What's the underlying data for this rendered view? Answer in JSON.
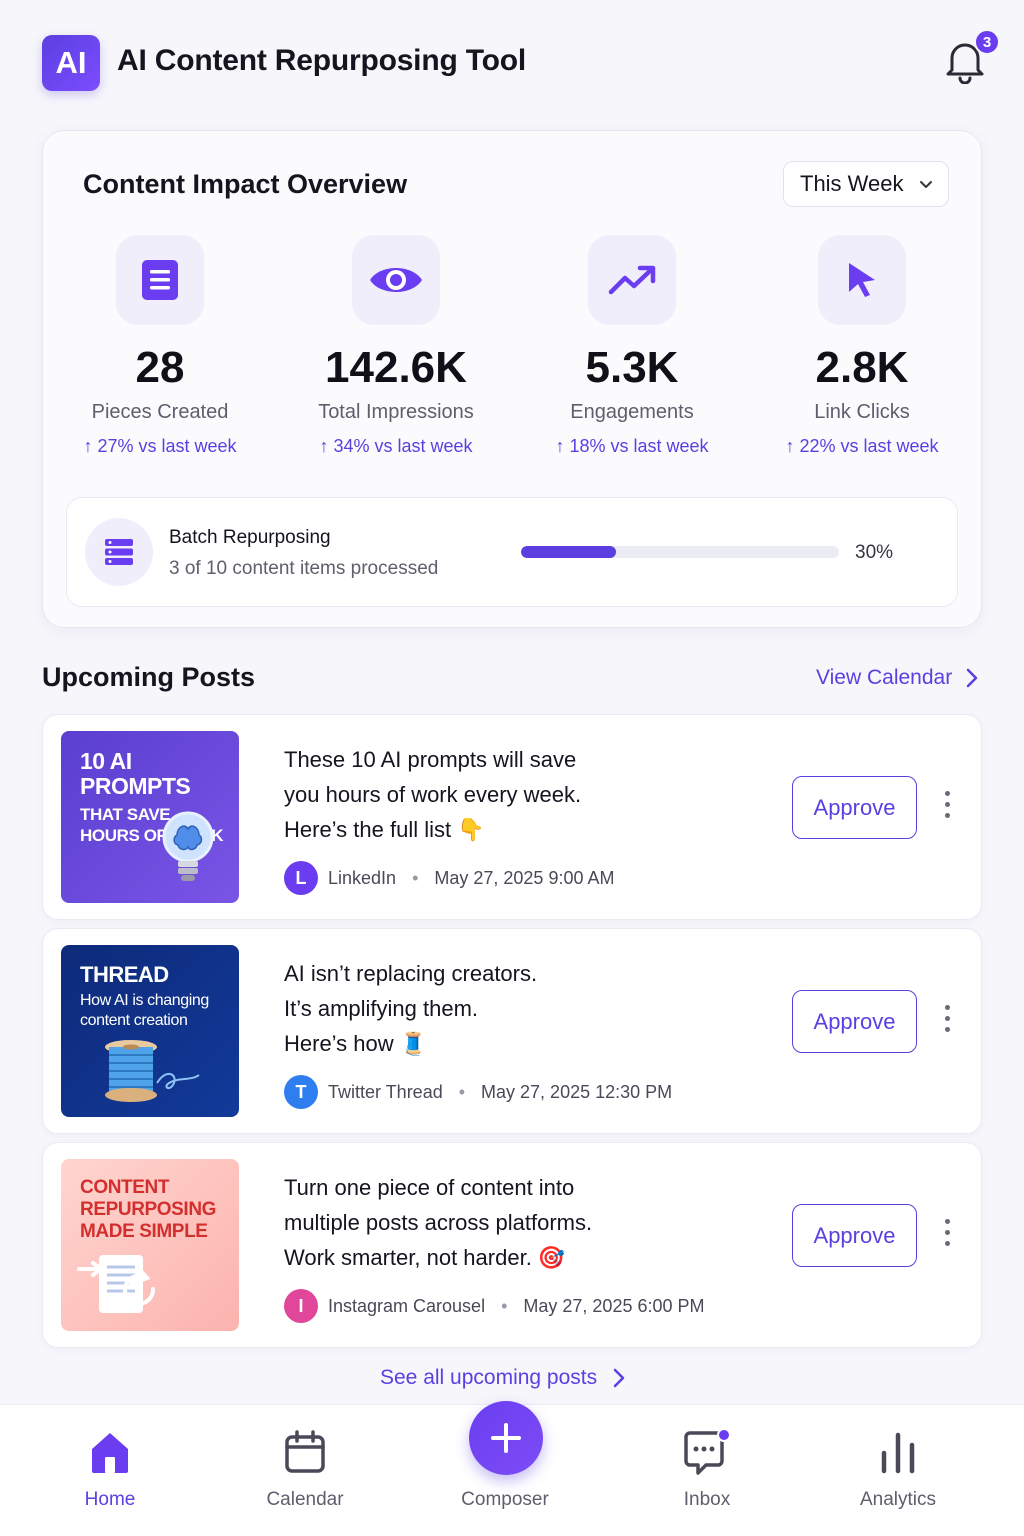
{
  "app": {
    "logo_text": "AI",
    "title": "AI Content Repurposing Tool",
    "notification_count": "3"
  },
  "overview": {
    "title": "Content Impact Overview",
    "period": "This Week",
    "stats": [
      {
        "icon": "document-icon",
        "value": "28",
        "label": "Pieces Created",
        "delta": "↑ 27% vs last week"
      },
      {
        "icon": "eye-icon",
        "value": "142.6K",
        "label": "Total Impressions",
        "delta": "↑ 34% vs last week"
      },
      {
        "icon": "trending-up-icon",
        "value": "5.3K",
        "label": "Engagements",
        "delta": "↑ 18% vs last week"
      },
      {
        "icon": "cursor-icon",
        "value": "2.8K",
        "label": "Link Clicks",
        "delta": "↑ 22% vs last week"
      }
    ],
    "batch": {
      "title": "Batch Repurposing",
      "subtitle": "3 of 10 content items processed",
      "progress": 0.3,
      "progress_label": "30%"
    }
  },
  "upcoming": {
    "title": "Upcoming Posts",
    "view_calendar": "View Calendar",
    "posts": [
      {
        "thumb_title": "10 AI PROMPTS",
        "thumb_sub": "THAT SAVE HOURS OF WORK",
        "text_lines": [
          "These 10 AI prompts will save",
          "you hours of work every week.",
          "Here’s the full list 👇"
        ],
        "avatar": "L",
        "avatar_color": "#6a3ef0",
        "platform": "LinkedIn",
        "datetime": "May 27, 2025 9:00 AM",
        "action": "Approve"
      },
      {
        "thumb_title": "THREAD",
        "thumb_sub": "How AI is changing content creation",
        "text_lines": [
          "AI isn’t replacing creators.",
          "It’s amplifying them.",
          "Here’s how 🧵"
        ],
        "avatar": "T",
        "avatar_color": "#2f7ef0",
        "platform": "Twitter Thread",
        "datetime": "May 27, 2025 12:30 PM",
        "action": "Approve"
      },
      {
        "thumb_title": "CONTENT REPURPOSING MADE SIMPLE",
        "thumb_sub": "",
        "text_lines": [
          "Turn one piece of content into",
          "multiple posts across platforms.",
          "Work smarter, not harder. 🎯"
        ],
        "avatar": "I",
        "avatar_color": "#e0479a",
        "platform": "Instagram Carousel",
        "datetime": "May 27, 2025 6:00 PM",
        "action": "Approve"
      }
    ],
    "see_all": "See all upcoming posts"
  },
  "nav": {
    "items": [
      {
        "label": "Home",
        "icon": "home-icon",
        "active": true
      },
      {
        "label": "Calendar",
        "icon": "calendar-icon"
      },
      {
        "label": "Composer",
        "icon": "plus-icon"
      },
      {
        "label": "Inbox",
        "icon": "chat-icon"
      },
      {
        "label": "Analytics",
        "icon": "bar-chart-icon"
      }
    ]
  },
  "colors": {
    "accent": "#5b3fe0",
    "accent_light": "#f1eefc",
    "background": "#f6f6fb"
  }
}
